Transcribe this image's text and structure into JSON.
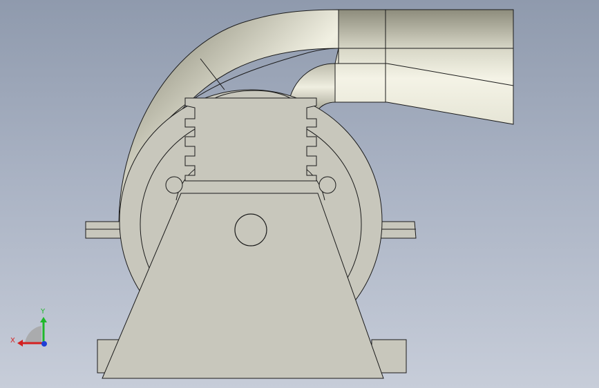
{
  "viewport": {
    "background_top": "#8f9aad",
    "background_bottom": "#c7cdd9",
    "part_fill": "#c8c7bc",
    "edge_color": "#1a1a1a",
    "pipe_light": "#f2f1e4",
    "pipe_dark": "#7f7e6f"
  },
  "triad": {
    "x_label": "X",
    "y_label": "Y",
    "x_color": "#d42020",
    "y_color": "#1fb82a",
    "z_color": "#1f3fd6"
  }
}
